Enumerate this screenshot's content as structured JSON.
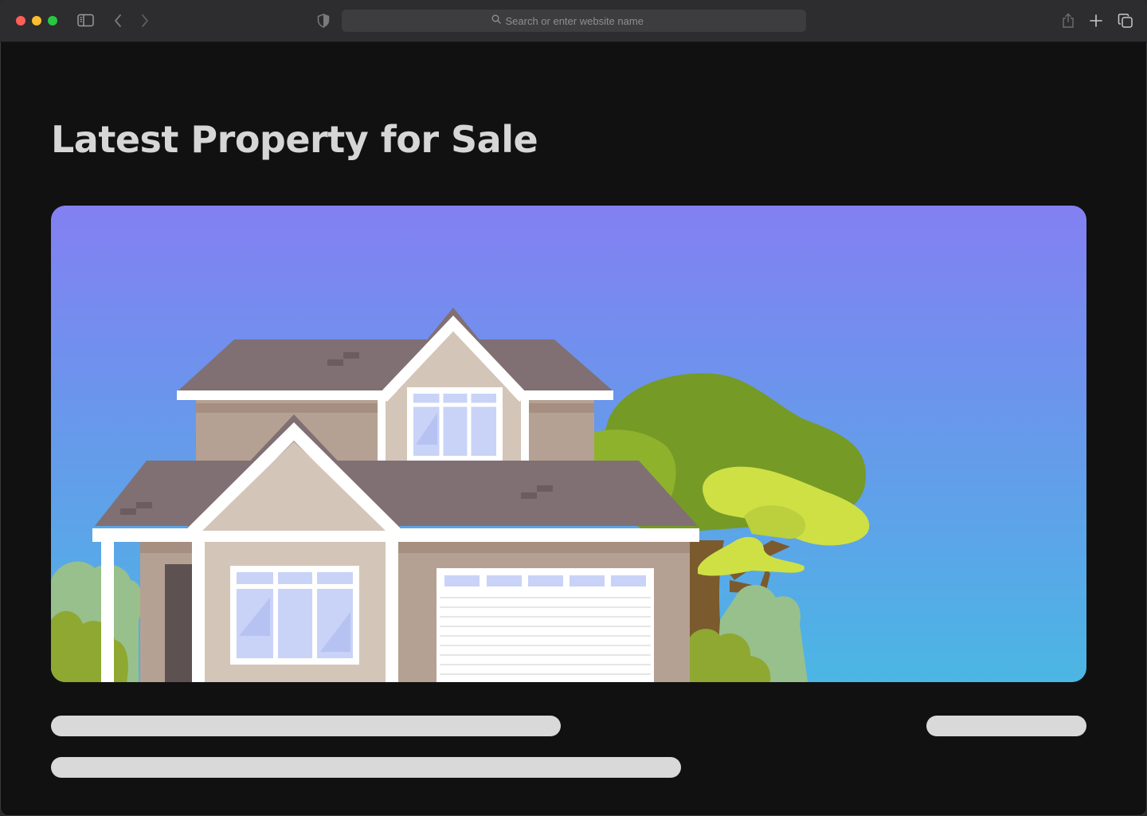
{
  "browser": {
    "address_placeholder": "Search or enter website name"
  },
  "page": {
    "title": "Latest Property for Sale"
  },
  "hero_image": {
    "subject": "house-illustration"
  },
  "icons": {
    "sidebar": "sidebar-icon",
    "back": "chevron-left-icon",
    "forward": "chevron-right-icon",
    "privacy": "shield-icon",
    "search": "search-icon",
    "share": "share-icon",
    "new_tab": "plus-icon",
    "tab_overview": "tabs-icon"
  },
  "colors": {
    "background": "#111111",
    "toolbar": "#2d2d2f",
    "title": "#d6d6d6",
    "skeleton": "#d9d9d9",
    "sky_top": "#8380f2",
    "sky_bottom": "#4bb6e4"
  }
}
